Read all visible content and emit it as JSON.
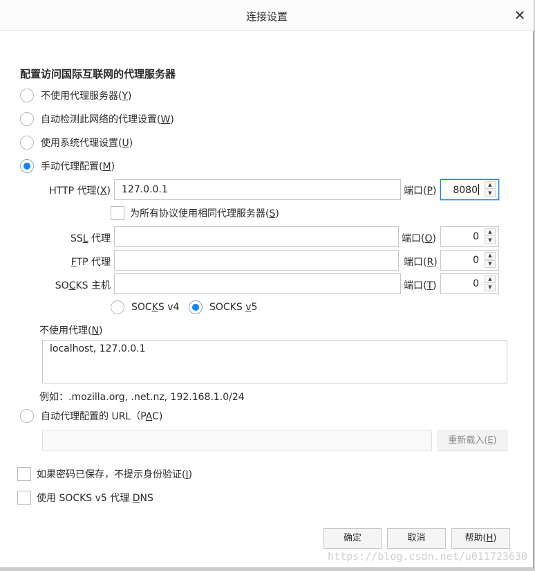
{
  "dialog": {
    "title": "连接设置",
    "close_glyph": "✕"
  },
  "section": {
    "heading": "配置访问国际互联网的代理服务器"
  },
  "proxy_modes": [
    {
      "label": "不使用代理服务器",
      "accel": "Y",
      "checked": false
    },
    {
      "label": "自动检测此网络的代理设置",
      "accel": "W",
      "checked": false
    },
    {
      "label": "使用系统代理设置",
      "accel": "U",
      "checked": false
    },
    {
      "label": "手动代理配置",
      "accel": "M",
      "checked": true
    }
  ],
  "manual": {
    "http": {
      "label_pre": "HTTP 代理(",
      "accel": "X",
      "label_post": ")",
      "value": "127.0.0.1",
      "port_label": "端口(",
      "port_accel": "P",
      "port_value": "8080"
    },
    "same_for_all": {
      "label": "为所有协议使用相同代理服务器",
      "accel": "S"
    },
    "ssl": {
      "label_pre": "SS",
      "accel": "L",
      "label_post": " 代理",
      "value": "",
      "port_label": "端口(",
      "port_accel": "O",
      "port_value": "0"
    },
    "ftp": {
      "label_pre": "",
      "accel": "F",
      "label_post": "TP 代理",
      "value": "",
      "port_label": "端口(",
      "port_accel": "R",
      "port_value": "0"
    },
    "socks": {
      "label_pre": "SO",
      "accel": "C",
      "label_post": "KS 主机",
      "value": "",
      "port_label": "端口(",
      "port_accel": "T",
      "port_value": "0"
    },
    "socks_v4": {
      "pre": "SOC",
      "accel": "K",
      "post": "S v4",
      "checked": false
    },
    "socks_v5": {
      "pre": "SOCKS ",
      "accel": "v",
      "post": "5",
      "checked": true
    },
    "no_proxy": {
      "label": "不使用代理",
      "accel": "N",
      "value": "localhost, 127.0.0.1"
    },
    "example": "例如：.mozilla.org, .net.nz, 192.168.1.0/24"
  },
  "pac": {
    "label_pre": "自动代理配置的 URL（P",
    "accel": "A",
    "label_post": "C)",
    "value": "",
    "reload_label": "重新载入(",
    "reload_accel": "E"
  },
  "options": [
    {
      "label": "如果密码已保存，不提示身份验证(",
      "accel": "I",
      "post": ")"
    },
    {
      "label": "使用 SOCKS v5 代理 ",
      "accel": "D",
      "post": "NS"
    }
  ],
  "buttons": {
    "ok": "确定",
    "cancel": "取消",
    "help_pre": "帮助(",
    "help_accel": "H"
  },
  "watermark": "https://blog.csdn.net/u011723630"
}
